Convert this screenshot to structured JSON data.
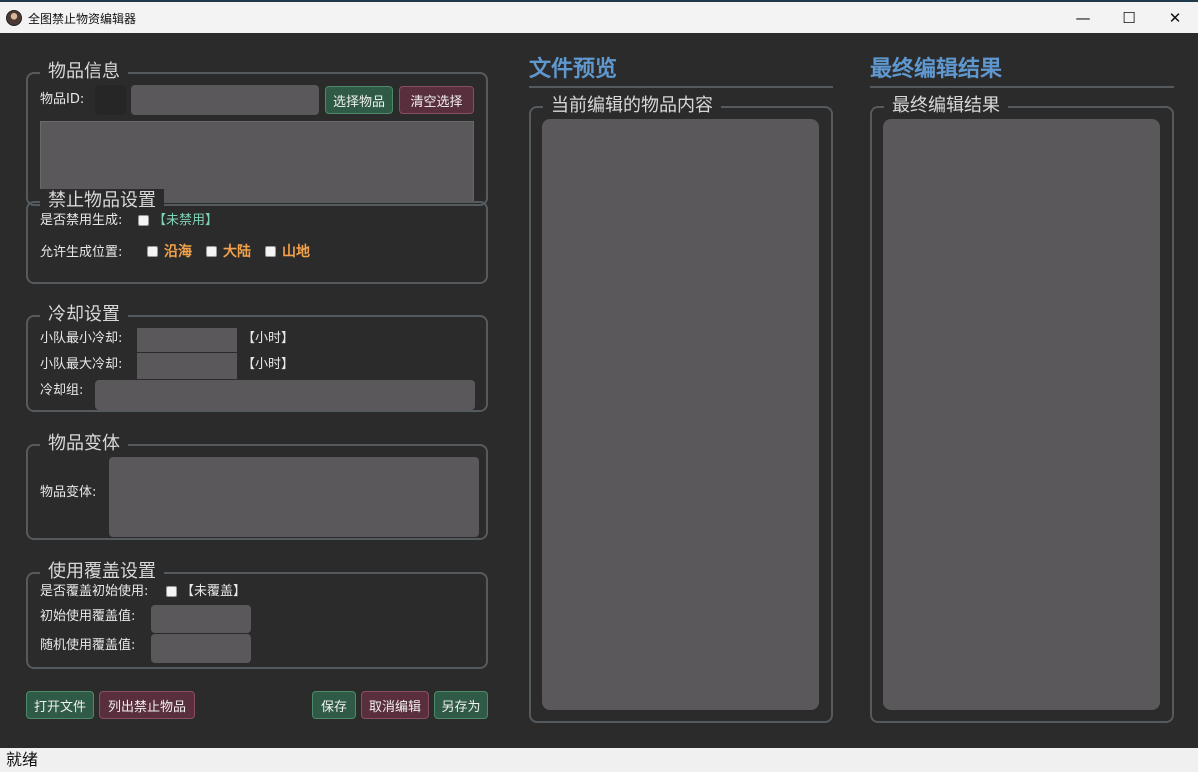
{
  "window": {
    "title": "全图禁止物资编辑器",
    "minimize_glyph": "—",
    "maximize_glyph": "☐",
    "close_glyph": "✕"
  },
  "item_info": {
    "title": "物品信息",
    "id_label": "物品ID:",
    "select_button": "选择物品",
    "clear_button": "清空选择"
  },
  "ban_settings": {
    "title": "禁止物品设置",
    "disable_label": "是否禁用生成:",
    "disable_status": "【未禁用】",
    "allow_label": "允许生成位置:",
    "locations": [
      "沿海",
      "大陆",
      "山地"
    ]
  },
  "cooldown": {
    "title": "冷却设置",
    "min_label": "小队最小冷却:",
    "max_label": "小队最大冷却:",
    "unit": "【小时】",
    "group_label": "冷却组:"
  },
  "variants": {
    "title": "物品变体",
    "label": "物品变体:"
  },
  "override": {
    "title": "使用覆盖设置",
    "override_label": "是否覆盖初始使用:",
    "override_status": "【未覆盖】",
    "initial_label": "初始使用覆盖值:",
    "random_label": "随机使用覆盖值:"
  },
  "bottom_buttons": {
    "open_file": "打开文件",
    "list_banned": "列出禁止物品",
    "save": "保存",
    "cancel_edit": "取消编辑",
    "save_as": "另存为"
  },
  "preview": {
    "heading": "文件预览",
    "group_title": "当前编辑的物品内容"
  },
  "result": {
    "heading": "最终编辑结果",
    "group_title": "最终编辑结果"
  },
  "status_bar": {
    "text": "就绪"
  }
}
